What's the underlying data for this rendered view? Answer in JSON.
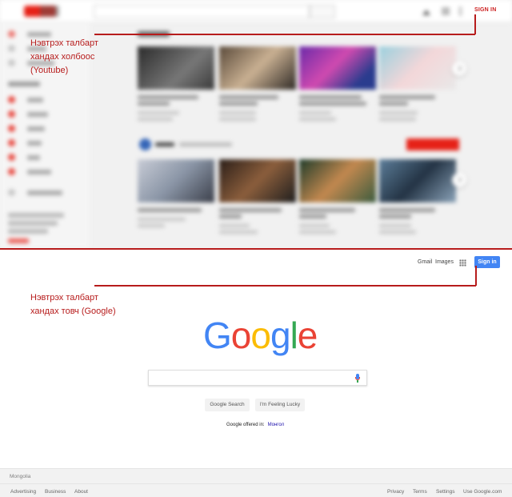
{
  "youtube": {
    "signin_label": "SIGN IN",
    "brand_color": "#e62117"
  },
  "google": {
    "gmail_label": "Gmail",
    "images_label": "Images",
    "signin_label": "Sign in",
    "logo_letters": [
      "G",
      "o",
      "o",
      "g",
      "l",
      "e"
    ],
    "search_button": "Google Search",
    "lucky_button": "I'm Feeling Lucky",
    "offered_in_label": "Google offered in:",
    "offered_language": "Монгол",
    "country": "Mongolia",
    "footer_left": [
      "Advertising",
      "Business",
      "About"
    ],
    "footer_right": [
      "Privacy",
      "Terms",
      "Settings",
      "Use Google.com"
    ],
    "signin_color": "#4285f4"
  },
  "annotations": {
    "youtube": [
      "Нэвтрэх талбарт",
      "хандах холбоос",
      "(Youtube)"
    ],
    "google": [
      "Нэвтрэх талбарт",
      "хандах товч (Google)"
    ],
    "color": "#b71c1c"
  }
}
